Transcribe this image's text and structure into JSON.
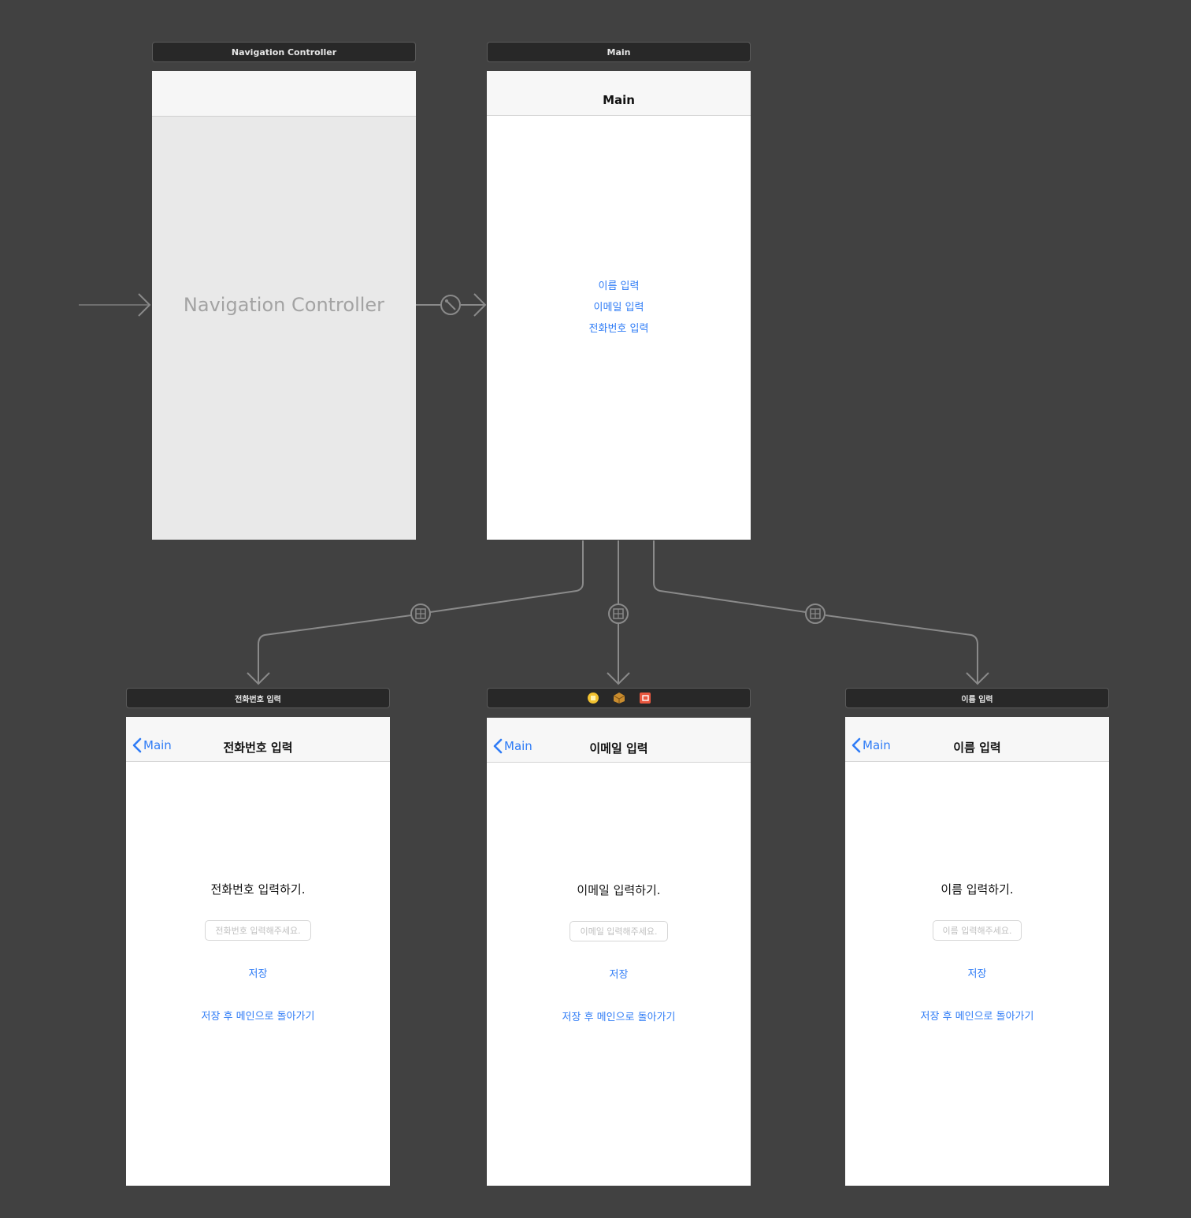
{
  "navigation_controller": {
    "bar_title": "Navigation Controller",
    "placeholder_label": "Navigation Controller"
  },
  "main_scene": {
    "bar_title": "Main",
    "nav_title": "Main",
    "buttons": [
      "이름 입력",
      "이메일 입력",
      "전화번호 입력"
    ]
  },
  "phone_scene": {
    "bar_title": "전화번호 입력",
    "back_label": "Main",
    "nav_title": "전화번호 입력",
    "prompt": "전화번호 입력하기.",
    "placeholder": "전화번호 입력해주세요.",
    "save_label": "저장",
    "save_return_label": "저장 후 메인으로 돌아가기"
  },
  "email_scene": {
    "bar_icons": [
      "view-controller-icon",
      "first-responder-icon",
      "exit-icon"
    ],
    "back_label": "Main",
    "nav_title": "이메일 입력",
    "prompt": "이메일 입력하기.",
    "placeholder": "이메일 입력해주세요.",
    "save_label": "저장",
    "save_return_label": "저장 후 메인으로 돌아가기"
  },
  "name_scene": {
    "bar_title": "이름 입력",
    "back_label": "Main",
    "nav_title": "이름 입력",
    "prompt": "이름 입력하기.",
    "placeholder": "이름 입력해주세요.",
    "save_label": "저장",
    "save_return_label": "저장 후 메인으로 돌아가기"
  },
  "colors": {
    "canvas": "#414141",
    "tint": "#2f7cf6",
    "connection": "#8a8a8a"
  }
}
